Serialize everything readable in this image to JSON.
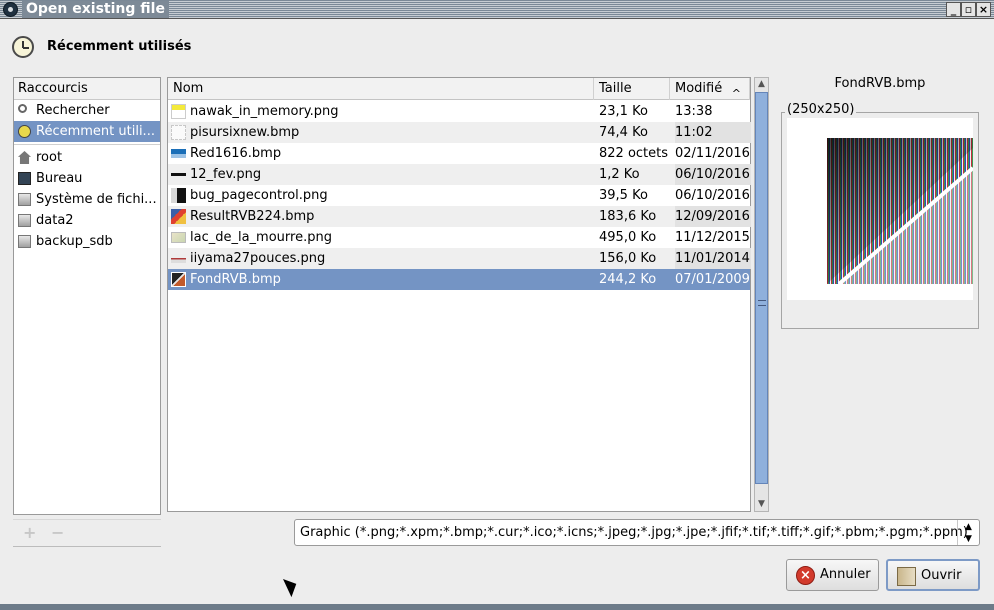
{
  "window": {
    "title": "Open existing file",
    "controls": [
      "_",
      "▫",
      "×"
    ]
  },
  "header": {
    "title": "Récemment utilisés"
  },
  "shortcuts": {
    "header": "Raccourcis",
    "items": [
      {
        "label": "Rechercher",
        "icon": "search-icon"
      },
      {
        "label": "Récemment utili...",
        "icon": "recent-icon",
        "selected": true
      },
      {
        "label": "root",
        "icon": "home-icon"
      },
      {
        "label": "Bureau",
        "icon": "desktop-icon"
      },
      {
        "label": "Système de fichi...",
        "icon": "drive-icon"
      },
      {
        "label": "data2",
        "icon": "drive-icon"
      },
      {
        "label": "backup_sdb",
        "icon": "drive-icon"
      }
    ],
    "add_label": "+",
    "remove_label": "−"
  },
  "file_list": {
    "columns": {
      "name": "Nom",
      "size": "Taille",
      "modified": "Modifié"
    },
    "sort_indicator": "^",
    "rows": [
      {
        "name": "nawak_in_memory.png",
        "size": "23,1 Ko",
        "modified": "13:38"
      },
      {
        "name": "pisursixnew.bmp",
        "size": "74,4 Ko",
        "modified": "11:02"
      },
      {
        "name": "Red1616.bmp",
        "size": "822 octets",
        "modified": "02/11/2016"
      },
      {
        "name": "12_fev.png",
        "size": "1,2 Ko",
        "modified": "06/10/2016"
      },
      {
        "name": "bug_pagecontrol.png",
        "size": "39,5 Ko",
        "modified": "06/10/2016"
      },
      {
        "name": "ResultRVB224.bmp",
        "size": "183,6 Ko",
        "modified": "12/09/2016"
      },
      {
        "name": "lac_de_la_mourre.png",
        "size": "495,0 Ko",
        "modified": "11/12/2015"
      },
      {
        "name": "iiyama27pouces.png",
        "size": "156,0 Ko",
        "modified": "11/01/2014"
      },
      {
        "name": "FondRVB.bmp",
        "size": "244,2 Ko",
        "modified": "07/01/2009",
        "selected": true
      }
    ]
  },
  "preview": {
    "filename": "FondRVB.bmp",
    "dimensions": "(250x250)"
  },
  "filter": {
    "value": "Graphic (*.png;*.xpm;*.bmp;*.cur;*.ico;*.icns;*.jpeg;*.jpg;*.jpe;*.jfif;*.tif;*.tiff;*.gif;*.pbm;*.pgm;*.ppm)"
  },
  "buttons": {
    "cancel": "Annuler",
    "open": "Ouvrir"
  },
  "colors": {
    "selection": "#7494c4",
    "scroll_thumb": "#8fb0dc"
  }
}
